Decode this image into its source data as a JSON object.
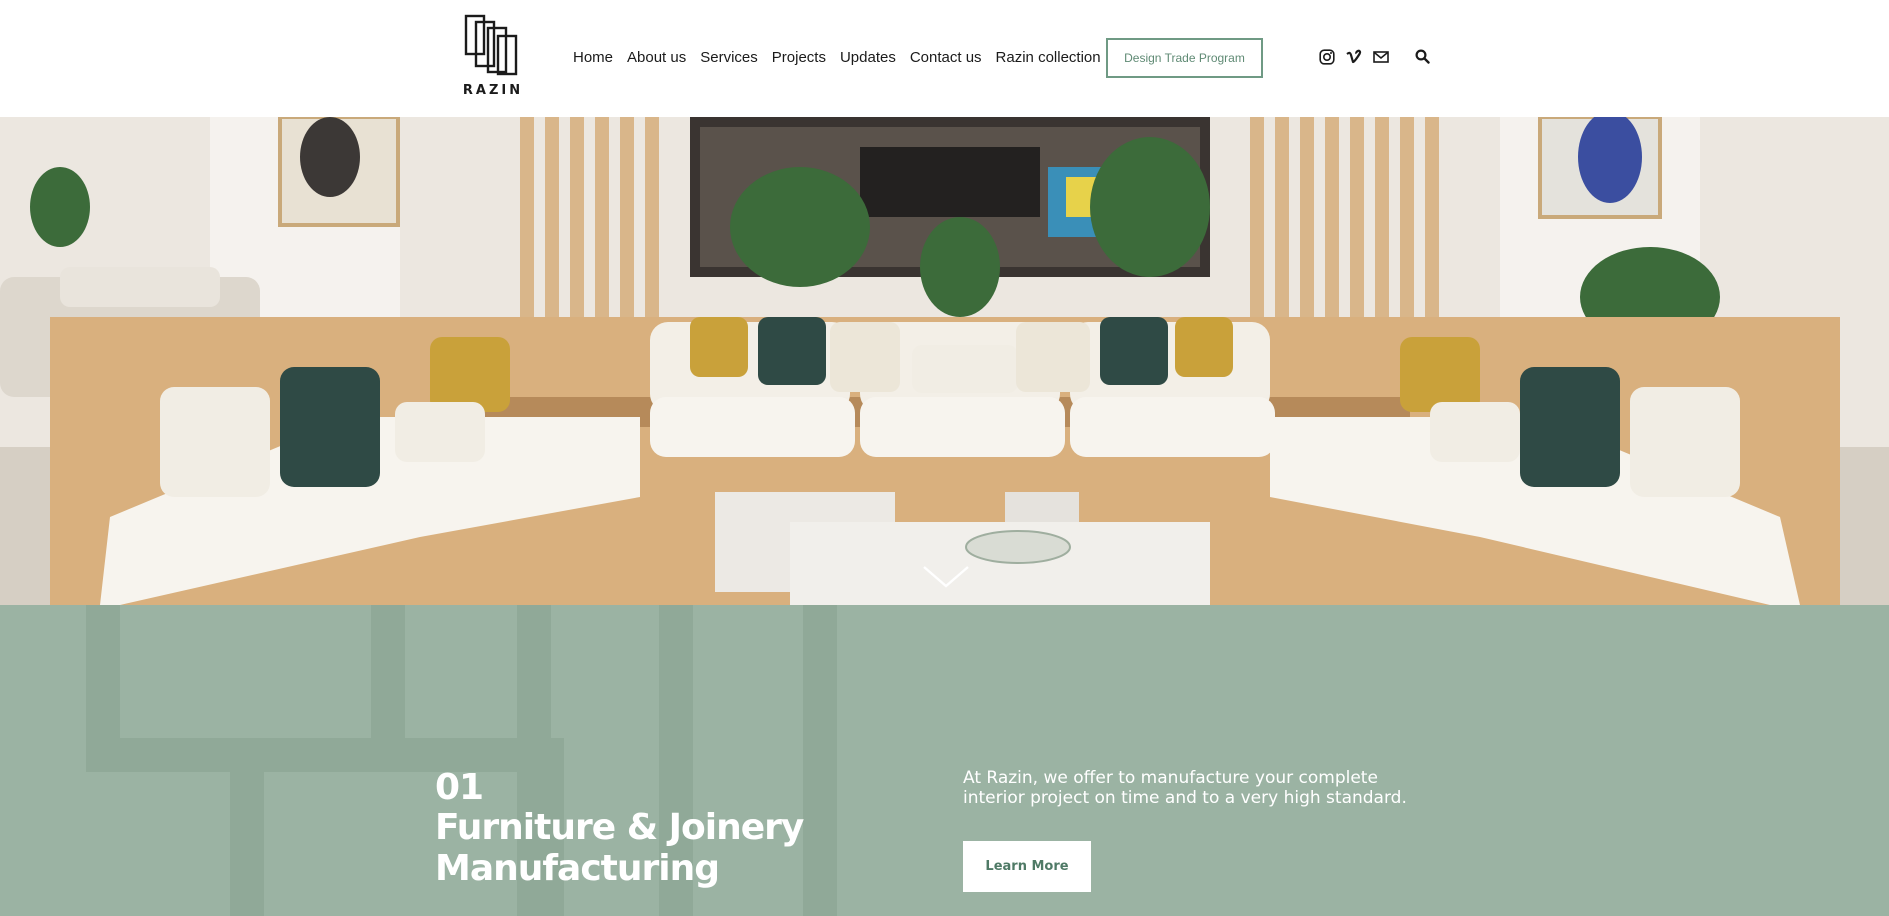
{
  "brand": {
    "name": "RAZIN",
    "accent": "#6f9a84",
    "section_bg": "#9bb3a3"
  },
  "nav": {
    "items": [
      {
        "label": "Home"
      },
      {
        "label": "About us"
      },
      {
        "label": "Services"
      },
      {
        "label": "Projects"
      },
      {
        "label": "Updates"
      },
      {
        "label": "Contact us"
      },
      {
        "label": "Razin collection"
      }
    ],
    "trade_button": "Design Trade Program",
    "social_icons": [
      "instagram-icon",
      "vimeo-icon",
      "email-icon"
    ],
    "search_icon": "search-icon"
  },
  "hero": {
    "scroll_icon": "chevron-down-icon"
  },
  "feature": {
    "number": "01",
    "title_line1": "Furniture & Joinery",
    "title_line2": "Manufacturing",
    "description": "At Razin, we offer to manufacture your complete interior project on time and to a very high standard.",
    "button": "Learn More"
  }
}
